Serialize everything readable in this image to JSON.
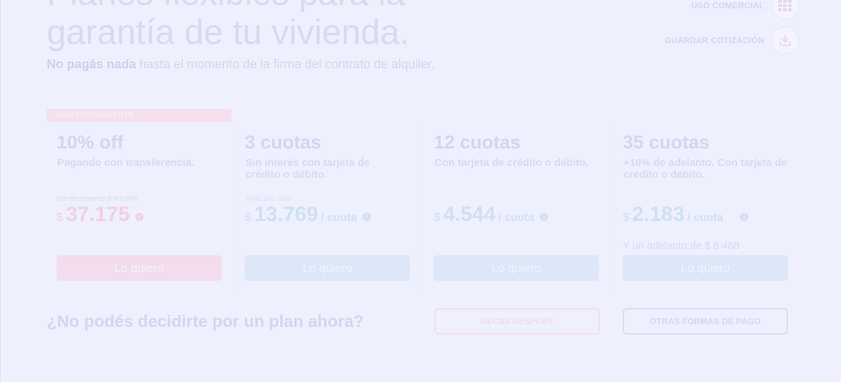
{
  "hero": {
    "title_line1": "Planes flexibles para la",
    "title_line2": "garantía de tu vivienda.",
    "subtitle_bold": "No pagás nada",
    "subtitle_rest": " hasta el momento de la firma del contrato de alquiler."
  },
  "actions": {
    "commercial_label": "USO COMERCIAL",
    "commercial_icon": "building-icon",
    "save_label": "GUARDAR COTIZACIÓN",
    "save_icon": "download-icon"
  },
  "badge": "MÁS CONVENIENTE",
  "plans": [
    {
      "title": "10% off",
      "description": "Pagando con transferencia.",
      "note": "Sin descuento $ 41.306",
      "currency": "$",
      "amount": "37.175",
      "per": "",
      "extra": "",
      "button": "Lo quiero"
    },
    {
      "title": "3 cuotas",
      "description": "Sin interés con tarjeta de crédito o débito.",
      "note": "Total $41.306",
      "currency": "$",
      "amount": "13.769",
      "per": "/ cuota",
      "extra": "",
      "button": "Lo quiero"
    },
    {
      "title": "12 cuotas",
      "description": "Con tarjeta de crédito o débito.",
      "note": "",
      "currency": "$",
      "amount": "4.544",
      "per": "/ cuota",
      "extra": "",
      "button": "Lo quiero"
    },
    {
      "title": "35 cuotas",
      "description": "+10% de adelanto. Con tarjeta de crédito o débito.",
      "note": "",
      "currency": "$",
      "amount": "2.183",
      "per": "/ cuota",
      "extra": "Y un adelanto de $ 8.488",
      "button": "Lo quiero"
    }
  ],
  "info_glyph": "i",
  "bottom": {
    "question": "¿No podés decidirte por un plan ahora?",
    "decide_later": "DECIDÍ DESPUÉS",
    "other_methods": "OTRAS FORMAS DE PAGO"
  },
  "colors": {
    "background": "#eef0fd",
    "accent_pink": "#f3dcee",
    "accent_blue": "#dde7f8"
  }
}
